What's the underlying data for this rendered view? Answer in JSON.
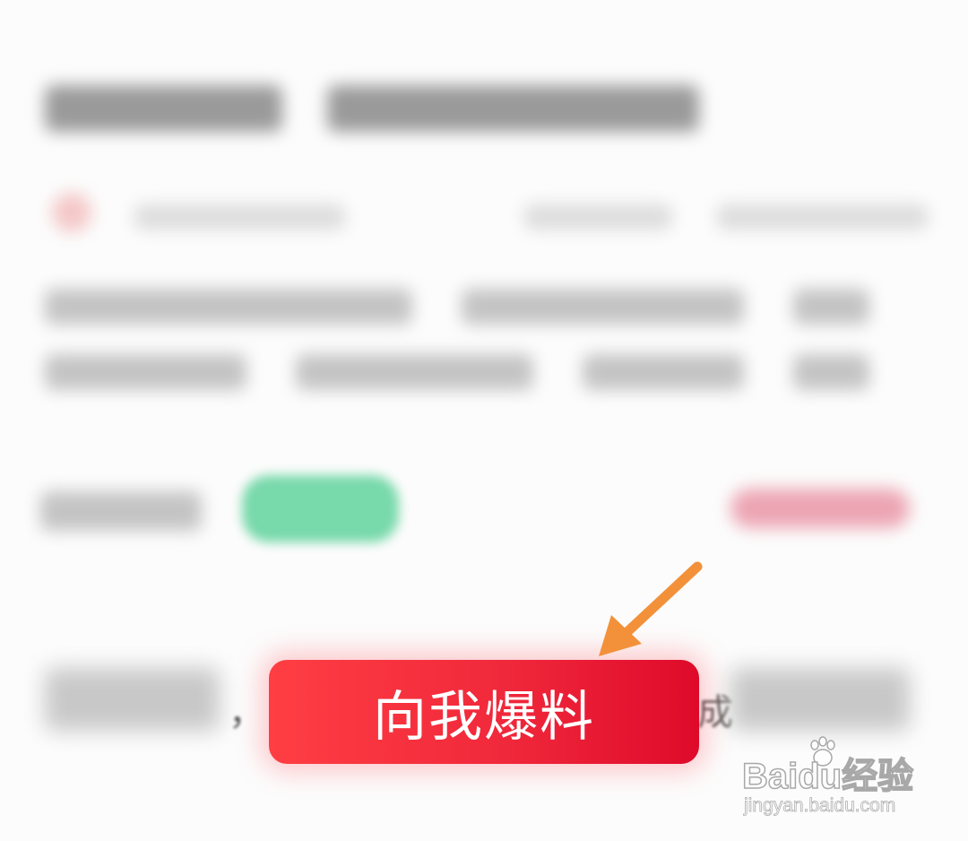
{
  "article": {
    "fragment_left": "，",
    "fragment_right": "成"
  },
  "report_button": {
    "label": "向我爆料"
  },
  "watermark": {
    "brand": "Baidu经验",
    "url": "jingyan.baidu.com"
  },
  "colors": {
    "button_start": "#ff3e43",
    "button_end": "#df0a2a",
    "arrow": "#f2913a",
    "tag_green": "#78d9ab",
    "tag_pink": "#eca5b3"
  },
  "icons": {
    "annotation": "arrow-pointer-icon",
    "watermark_logo": "baidu-paw-icon"
  }
}
